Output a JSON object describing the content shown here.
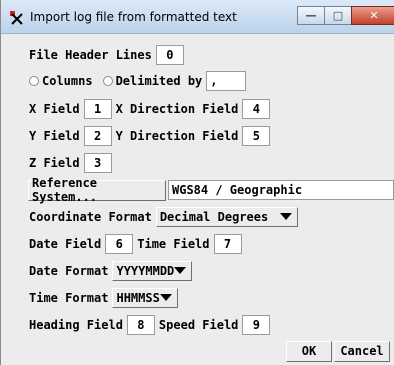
{
  "window": {
    "title": "Import log file from formatted text"
  },
  "header_lines": {
    "label": "File Header Lines",
    "value": "0"
  },
  "format": {
    "columns_label": "Columns",
    "delimited_label": "Delimited by",
    "delimiter": ","
  },
  "x_field": {
    "label": "X Field",
    "value": "1"
  },
  "x_dir": {
    "label": "X Direction Field",
    "value": "4"
  },
  "y_field": {
    "label": "Y Field",
    "value": "2"
  },
  "y_dir": {
    "label": "Y Direction Field",
    "value": "5"
  },
  "z_field": {
    "label": "Z Field",
    "value": "3"
  },
  "reference": {
    "button_label": "Reference System...",
    "value": "WGS84 / Geographic"
  },
  "coord_format": {
    "label": "Coordinate Format",
    "value": "Decimal Degrees"
  },
  "date_field": {
    "label": "Date Field",
    "value": "6"
  },
  "time_field": {
    "label": "Time Field",
    "value": "7"
  },
  "date_format": {
    "label": "Date Format",
    "value": "YYYYMMDD"
  },
  "time_format": {
    "label": "Time Format",
    "value": "HHMMSS"
  },
  "heading_field": {
    "label": "Heading Field",
    "value": "8"
  },
  "speed_field": {
    "label": "Speed Field",
    "value": "9"
  },
  "buttons": {
    "ok": "OK",
    "cancel": "Cancel"
  },
  "icons": {
    "app": "import-log-app-icon",
    "minimize": "minimize-icon",
    "maximize": "maximize-icon",
    "close": "close-icon",
    "dropdown": "chevron-down-icon"
  }
}
